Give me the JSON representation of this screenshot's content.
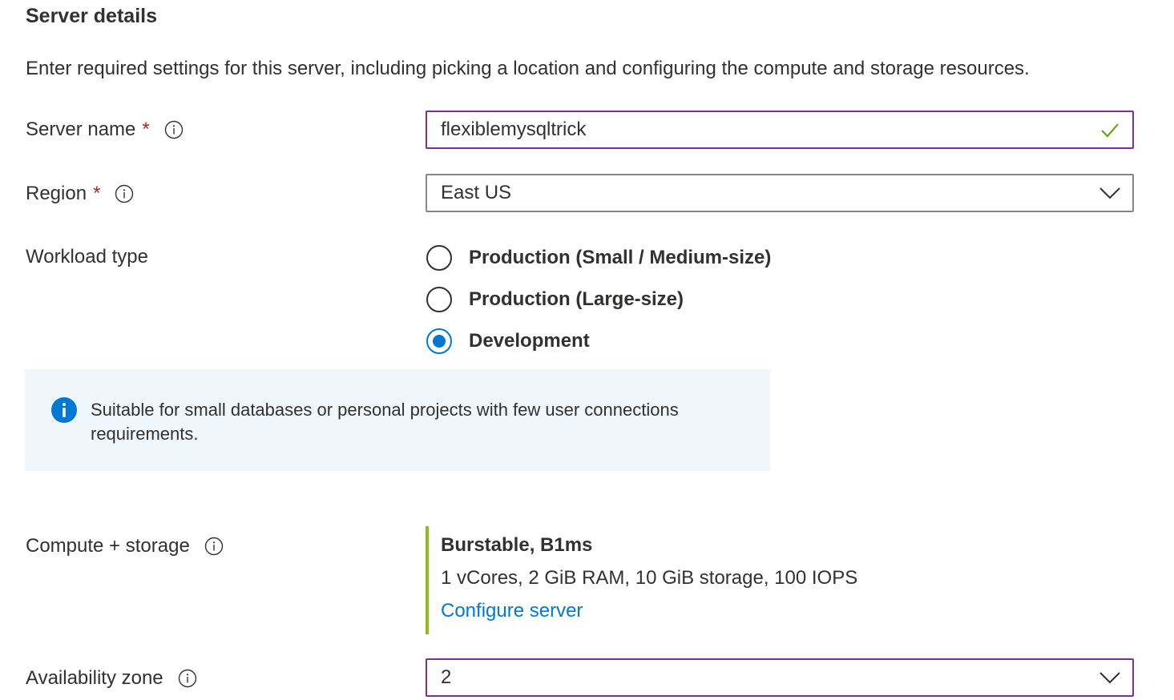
{
  "section": {
    "title": "Server details",
    "description": "Enter required settings for this server, including picking a location and configuring the compute and storage resources."
  },
  "server_name": {
    "label": "Server name",
    "required_marker": "*",
    "value": "flexiblemysqltrick",
    "status_icon": "checkmark-icon",
    "status_color": "#57a300"
  },
  "region": {
    "label": "Region",
    "required_marker": "*",
    "value": "East US"
  },
  "workload_type": {
    "label": "Workload type",
    "options": [
      {
        "label": "Production (Small / Medium-size)",
        "selected": false
      },
      {
        "label": "Production (Large-size)",
        "selected": false
      },
      {
        "label": "Development",
        "selected": true
      }
    ]
  },
  "info_box": {
    "text": "Suitable for small databases or personal projects with few user connections requirements.",
    "icon": "info-filled-icon",
    "background": "#eff6fc"
  },
  "compute_storage": {
    "label": "Compute + storage",
    "tier": "Burstable, B1ms",
    "spec": "1 vCores, 2 GiB RAM, 10 GiB storage, 100 IOPS",
    "link": "Configure server",
    "accent_color": "#8cbd18"
  },
  "availability_zone": {
    "label": "Availability zone",
    "value": "2"
  },
  "colors": {
    "accent": "#0078d4",
    "focus_border": "#7a2f9a",
    "required": "#a4262c"
  }
}
